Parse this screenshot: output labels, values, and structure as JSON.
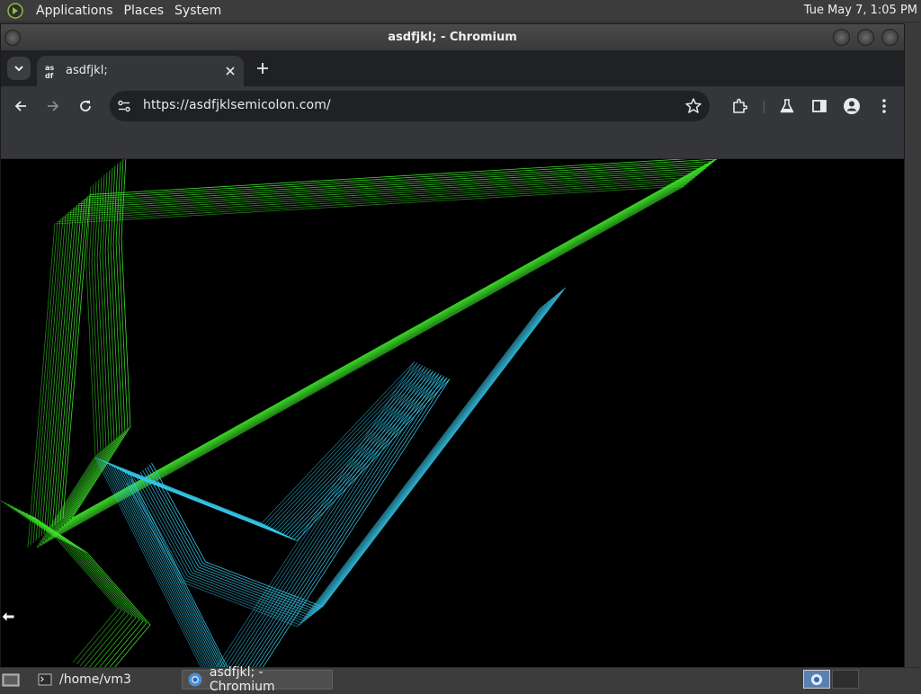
{
  "top_panel": {
    "menus": [
      "Applications",
      "Places",
      "System"
    ],
    "clock": "Tue May  7,  1:05 PM"
  },
  "window": {
    "title": "asdfjkl; - Chromium"
  },
  "browser": {
    "tab": {
      "title": "asdfjkl;",
      "favicon_text_top": "as",
      "favicon_text_bottom": "df"
    },
    "address_bar": {
      "url": "https://asdfjklsemicolon.com/"
    }
  },
  "taskbar": {
    "tasks": [
      {
        "label": "/home/vm3",
        "icon": "terminal-icon"
      },
      {
        "label": "asdfjkl; - Chromium",
        "icon": "chromium-icon"
      }
    ]
  },
  "colors": {
    "green_lines": "#3ee82a",
    "cyan_lines": "#35c6e8",
    "background": "#000000"
  }
}
